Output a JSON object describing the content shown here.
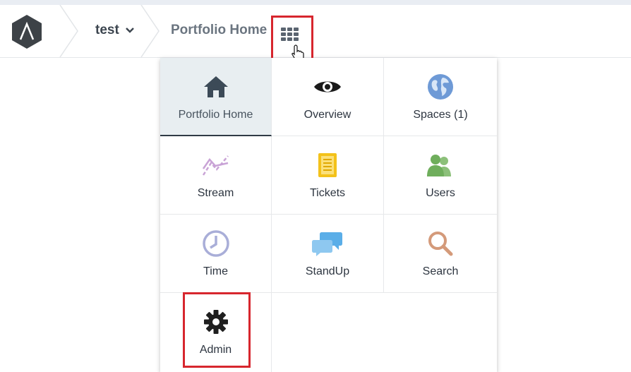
{
  "header": {
    "project_name": "test",
    "page_title": "Portfolio Home",
    "icons": {
      "logo": "assembla-logo-icon",
      "project_dropdown": "chevron-down-icon",
      "app_switcher": "grid-icon",
      "cursor": "hand-pointer-icon"
    }
  },
  "menu": {
    "items": [
      {
        "label": "Portfolio Home",
        "icon": "home-icon",
        "color": "#3c4a57"
      },
      {
        "label": "Overview",
        "icon": "eye-icon",
        "color": "#1a1a1a"
      },
      {
        "label": "Spaces (1)",
        "icon": "globe-icon",
        "color": "#6e9ad6"
      },
      {
        "label": "Stream",
        "icon": "stream-chart-icon",
        "color": "#c9a3d6"
      },
      {
        "label": "Tickets",
        "icon": "ticket-icon",
        "color": "#f3c21a"
      },
      {
        "label": "Users",
        "icon": "users-icon",
        "color": "#8cc07a"
      },
      {
        "label": "Time",
        "icon": "clock-icon",
        "color": "#a9aed8"
      },
      {
        "label": "StandUp",
        "icon": "chat-bubbles-icon",
        "color": "#5aaee8"
      },
      {
        "label": "Search",
        "icon": "search-icon",
        "color": "#d49a7a"
      },
      {
        "label": "Admin",
        "icon": "gear-icon",
        "color": "#1f1f1f"
      }
    ]
  },
  "colors": {
    "highlight_box": "#d7262e",
    "active_tile_bg": "#e8eef1"
  }
}
